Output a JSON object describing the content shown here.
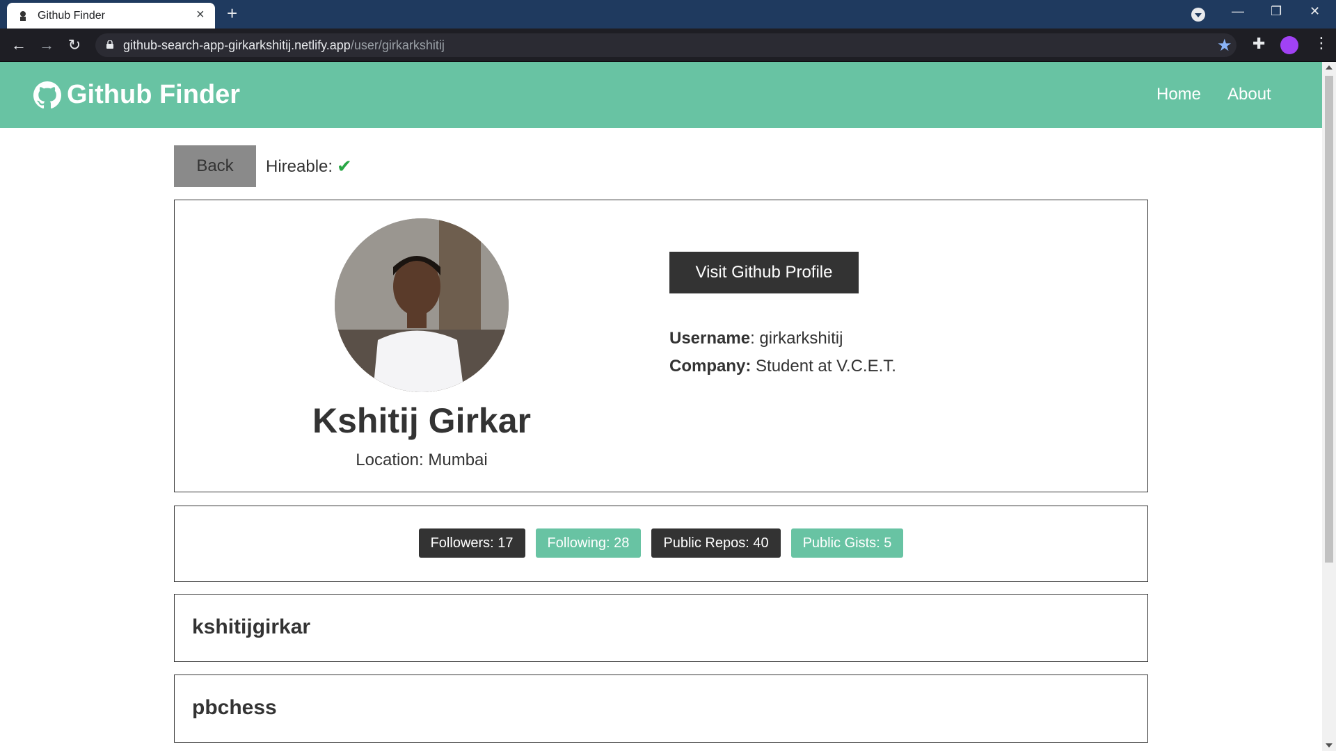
{
  "browser": {
    "tab_title": "Github Finder",
    "url_host": "github-search-app-girkarkshitij.netlify.app",
    "url_path": "/user/girkarkshitij"
  },
  "navbar": {
    "brand": "Github Finder",
    "links": [
      "Home",
      "About"
    ]
  },
  "page": {
    "back_label": "Back",
    "hireable_label": "Hireable:",
    "hireable_mark": "✔"
  },
  "profile": {
    "name": "Kshitij Girkar",
    "location": "Location: Mumbai",
    "visit_label": "Visit Github Profile",
    "username_label": "Username",
    "username_value": ": girkarkshitij",
    "company_label": "Company:",
    "company_value": " Student at V.C.E.T."
  },
  "stats": {
    "followers": "Followers: 17",
    "following": "Following: 28",
    "public_repos": "Public Repos: 40",
    "public_gists": "Public Gists: 5"
  },
  "repos": [
    "kshitijgirkar",
    "pbchess"
  ],
  "colors": {
    "accent": "#68c3a3",
    "dark": "#333333",
    "success": "#28a745"
  },
  "icons": {
    "brand": "github-icon",
    "hireable": "check-icon"
  }
}
